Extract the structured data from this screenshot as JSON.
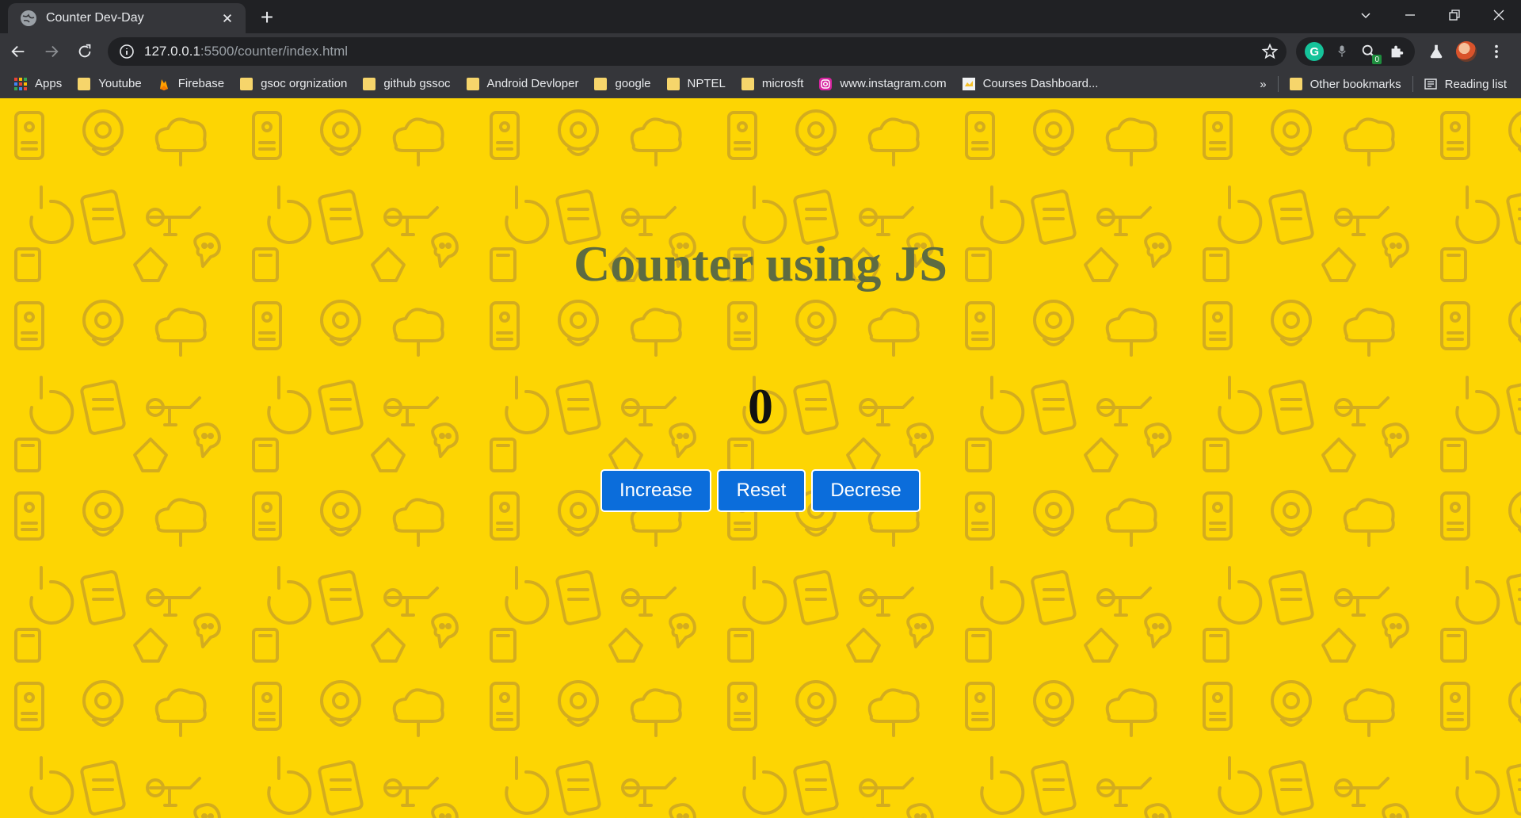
{
  "browser": {
    "tab": {
      "title": "Counter Dev-Day",
      "favicon": "globe-icon"
    },
    "new_tab_label": "+",
    "address": {
      "host": "127.0.0.1",
      "path": ":5500/counter/index.html"
    },
    "extensions": [
      {
        "name": "grammarly-icon",
        "letter": "G"
      },
      {
        "name": "extension-icon"
      },
      {
        "name": "search-extension-icon",
        "badge": "0"
      },
      {
        "name": "puzzle-icon"
      },
      {
        "name": "flask-icon"
      }
    ],
    "bookmarks": [
      {
        "label": "Apps",
        "icon": "apps-grid-icon"
      },
      {
        "label": "Youtube",
        "icon": "folder-icon"
      },
      {
        "label": "Firebase",
        "icon": "firebase-icon"
      },
      {
        "label": "gsoc orgnization",
        "icon": "folder-icon"
      },
      {
        "label": "github gssoc",
        "icon": "folder-icon"
      },
      {
        "label": "Android Devloper",
        "icon": "folder-icon"
      },
      {
        "label": "google",
        "icon": "folder-icon"
      },
      {
        "label": "NPTEL",
        "icon": "folder-icon"
      },
      {
        "label": "microsft",
        "icon": "folder-icon"
      },
      {
        "label": "www.instagram.com",
        "icon": "instagram-icon"
      },
      {
        "label": "Courses Dashboard...",
        "icon": "courses-icon"
      }
    ],
    "bookmarks_overflow": "»",
    "other_bookmarks": "Other bookmarks",
    "reading_list": "Reading list"
  },
  "page": {
    "heading": "Counter using JS",
    "count": "0",
    "buttons": {
      "increase": "Increase",
      "reset": "Reset",
      "decrease": "Decrese"
    },
    "colors": {
      "background": "#fdd503",
      "heading": "#5d6b42",
      "button": "#0b6ddb"
    }
  }
}
